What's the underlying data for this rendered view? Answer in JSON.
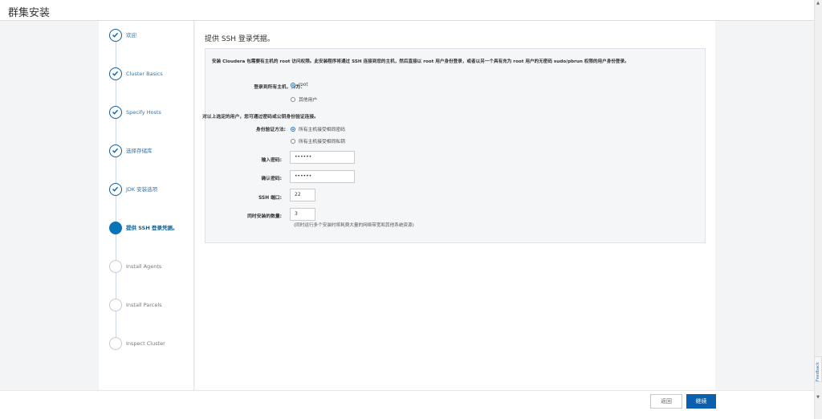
{
  "header": {
    "title": "群集安装"
  },
  "steps": [
    {
      "label": "欢迎",
      "status": "done"
    },
    {
      "label": "Cluster Basics",
      "status": "done"
    },
    {
      "label": "Specify Hosts",
      "status": "done"
    },
    {
      "label": "选择存储库",
      "status": "done"
    },
    {
      "label": "JDK 安装选项",
      "status": "done"
    },
    {
      "label": "提供 SSH 登录凭据。",
      "status": "active"
    },
    {
      "label": "Install Agents",
      "status": "pending"
    },
    {
      "label": "Install Parcels",
      "status": "pending"
    },
    {
      "label": "Inspect Cluster",
      "status": "pending"
    }
  ],
  "main": {
    "title": "提供 SSH 登录凭据。",
    "intro": "安装 Cloudera 包需要有主机的 root 访问权限。此安装程序将通过 SSH 连接到您的主机，然后直接以 root 用户身份登录，或者以另一个具有充为 root 用户的无密码 sudo/pbrun 权限的用户身份登录。",
    "login_label": "登录到所有主机，作为：",
    "login_options": [
      {
        "label": "root",
        "selected": true
      },
      {
        "label": "其他用户",
        "selected": false
      }
    ],
    "auth_note": "对以上选定的用户，您可通过密码或公钥身份验证连接。",
    "auth_label": "身份验证方法:",
    "auth_options": [
      {
        "label": "所有主机接受相同密码",
        "selected": true
      },
      {
        "label": "所有主机接受相同私钥",
        "selected": false
      }
    ],
    "password_label": "输入密码:",
    "password_value": "••••••",
    "confirm_label": "确认密码:",
    "confirm_value": "••••••",
    "ssh_port_label": "SSH 端口:",
    "ssh_port_value": "22",
    "concurrent_label": "同时安装的数量:",
    "concurrent_value": "3",
    "concurrent_hint": "(同时运行多个安装时将耗费大量的网络带宽和其他系统资源)"
  },
  "footer": {
    "back_label": "返回",
    "next_label": "继续"
  },
  "feedback_label": "Feedback",
  "colors": {
    "accent": "#0a74b9",
    "primary_button": "#0a5fae"
  }
}
